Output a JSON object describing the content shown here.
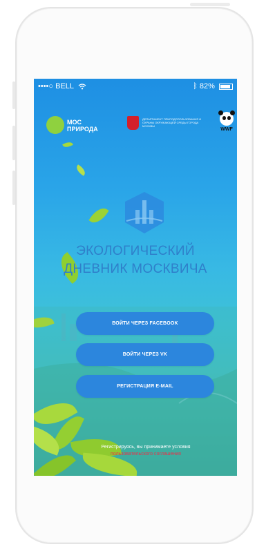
{
  "status_bar": {
    "carrier": "••••○ BELL",
    "battery_percent": "82%",
    "icons": [
      "wifi-icon",
      "bluetooth-icon",
      "battery-icon"
    ]
  },
  "logos": {
    "mos_priroda": "МОС\nПРИРОДА",
    "department": "ДЕПАРТАМЕНТ ПРИРОДОПОЛЬЗОВАНИЯ И ОХРАНЫ ОКРУЖАЮЩЕЙ СРЕДЫ ГОРОДА МОСКВЫ",
    "wwf": "WWF"
  },
  "app": {
    "title_line1": "ЭКОЛОГИЧЕСКИЙ",
    "title_line2": "ДНЕВНИК МОСКВИЧА"
  },
  "buttons": {
    "facebook": "ВОЙТИ ЧЕРЕЗ FACEBOOK",
    "vk": "ВОЙТИ ЧЕРЕЗ VK",
    "email": "РЕГИСТРАЦИЯ E-MAIL"
  },
  "terms": {
    "line1": "Регистрируясь, вы принимаете условия",
    "line2": "пользовательского соглашения"
  },
  "colors": {
    "button_bg": "#2c86dd",
    "title": "#2f7fca",
    "terms_link": "#e8324a",
    "leaf": "#9bd235"
  }
}
